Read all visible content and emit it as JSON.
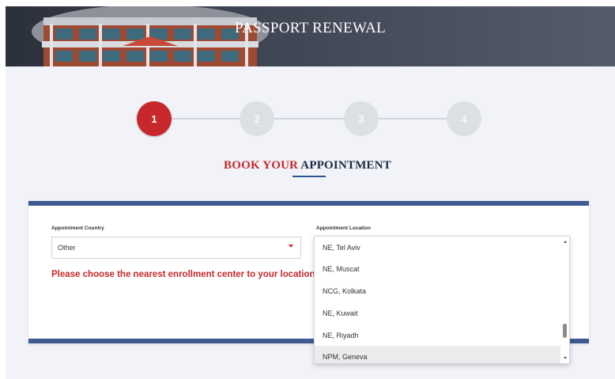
{
  "banner": {
    "title": "PASSPORT RENEWAL"
  },
  "stepper": {
    "steps": [
      {
        "label": "1",
        "active": true
      },
      {
        "label": "2",
        "active": false
      },
      {
        "label": "3",
        "active": false
      },
      {
        "label": "4",
        "active": false
      }
    ]
  },
  "heading": {
    "part1": "BOOK YOUR",
    "part2": "APPOINTMENT"
  },
  "form": {
    "country": {
      "label": "Appointment Country",
      "value": "Other"
    },
    "location": {
      "label": "Appointment Location",
      "options": [
        "NE, Tel Aviv",
        "NE, Muscat",
        "NCG, Kolkata",
        "NE, Kuwait",
        "NE, Riyadh",
        "NPM, Geneva"
      ],
      "highlighted": "NPM, Geneva"
    },
    "error": "Please choose the nearest enrollment center to your location."
  },
  "colors": {
    "accent_red": "#c6282c",
    "brand_blue": "#3d5a91"
  },
  "icons": {
    "dropdown_caret": "caret-down-icon",
    "scroll_up": "scroll-up-arrow-icon",
    "scroll_down": "scroll-down-arrow-icon"
  }
}
